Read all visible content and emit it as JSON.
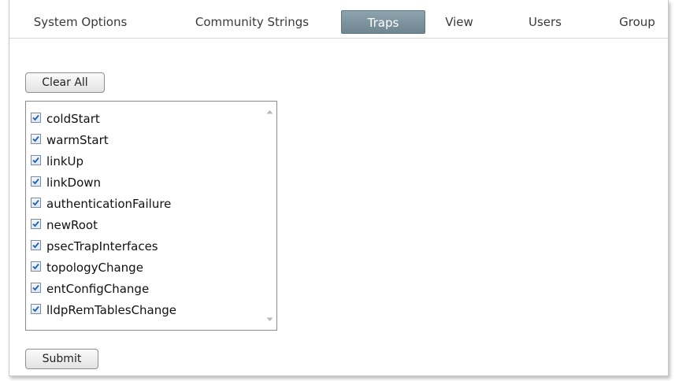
{
  "tabs": [
    {
      "label": "System Options"
    },
    {
      "label": "Community Strings"
    },
    {
      "label": "Traps",
      "active": true
    },
    {
      "label": "View"
    },
    {
      "label": "Users"
    },
    {
      "label": "Group"
    }
  ],
  "buttons": {
    "clear_all": "Clear All",
    "submit": "Submit"
  },
  "traps": [
    {
      "label": "coldStart",
      "checked": true
    },
    {
      "label": "warmStart",
      "checked": true
    },
    {
      "label": "linkUp",
      "checked": true
    },
    {
      "label": "linkDown",
      "checked": true
    },
    {
      "label": "authenticationFailure",
      "checked": true
    },
    {
      "label": "newRoot",
      "checked": true
    },
    {
      "label": "psecTrapInterfaces",
      "checked": true
    },
    {
      "label": "topologyChange",
      "checked": true
    },
    {
      "label": "entConfigChange",
      "checked": true
    },
    {
      "label": "lldpRemTablesChange",
      "checked": true
    }
  ],
  "colors": {
    "active_tab": "#7f97a2",
    "checkmark": "#1f5fb0"
  }
}
